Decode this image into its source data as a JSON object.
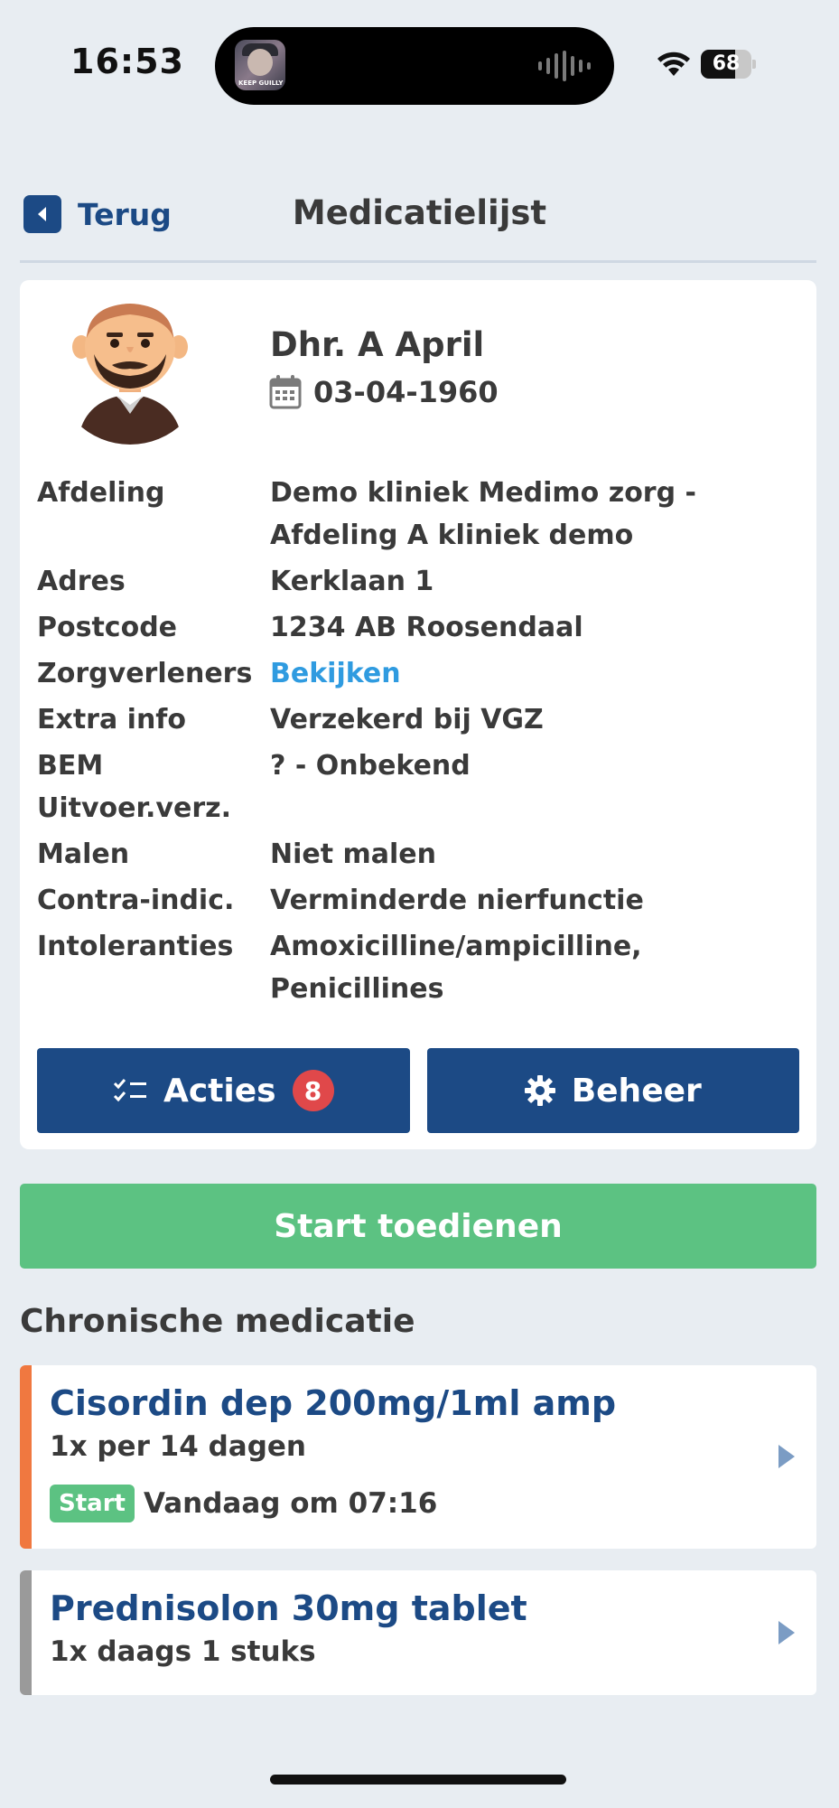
{
  "status_bar": {
    "time": "16:53",
    "battery": "68",
    "battery_level": 0.68,
    "thumb_text": "KEEP GUILLY"
  },
  "header": {
    "back_label": "Terug",
    "title": "Medicatielijst"
  },
  "patient": {
    "name": "Dhr. A April",
    "dob": "03-04-1960",
    "info": [
      {
        "label": "Afdeling",
        "value": "Demo kliniek Medimo zorg - Afdeling A kliniek demo"
      },
      {
        "label": "Adres",
        "value": "Kerklaan 1"
      },
      {
        "label": "Postcode",
        "value": "1234 AB Roosendaal"
      },
      {
        "label": "Zorgverleners",
        "value": "Bekijken"
      },
      {
        "label": "Extra info",
        "value": "Verzekerd bij VGZ"
      },
      {
        "label": "BEM Uitvoer.verz.",
        "value": "? - Onbekend"
      },
      {
        "label": "Malen",
        "value": "Niet malen"
      },
      {
        "label": "Contra-indic.",
        "value": "Verminderde nierfunctie"
      },
      {
        "label": "Intoleranties",
        "value": "Amoxicilline/ampicilline, Penicillines"
      }
    ],
    "actions_label": "Acties",
    "actions_count": "8",
    "manage_label": "Beheer"
  },
  "start_label": "Start toedienen",
  "section_title": "Chronische medicatie",
  "medications": [
    {
      "name": "Cisordin dep 200mg/1ml amp",
      "dose": "1x per 14 dagen",
      "start_badge": "Start",
      "start_text": "Vandaag om 07:16",
      "stripe_color": "#f07840"
    },
    {
      "name": "Prednisolon 30mg tablet",
      "dose": "1x daags 1 stuks",
      "stripe_color": "#9a9a9a"
    }
  ],
  "colors": {
    "primary": "#1c4a85",
    "success": "#5cc282",
    "link": "#2f9be0",
    "badge": "#e0484a",
    "background": "#e8edf2"
  }
}
